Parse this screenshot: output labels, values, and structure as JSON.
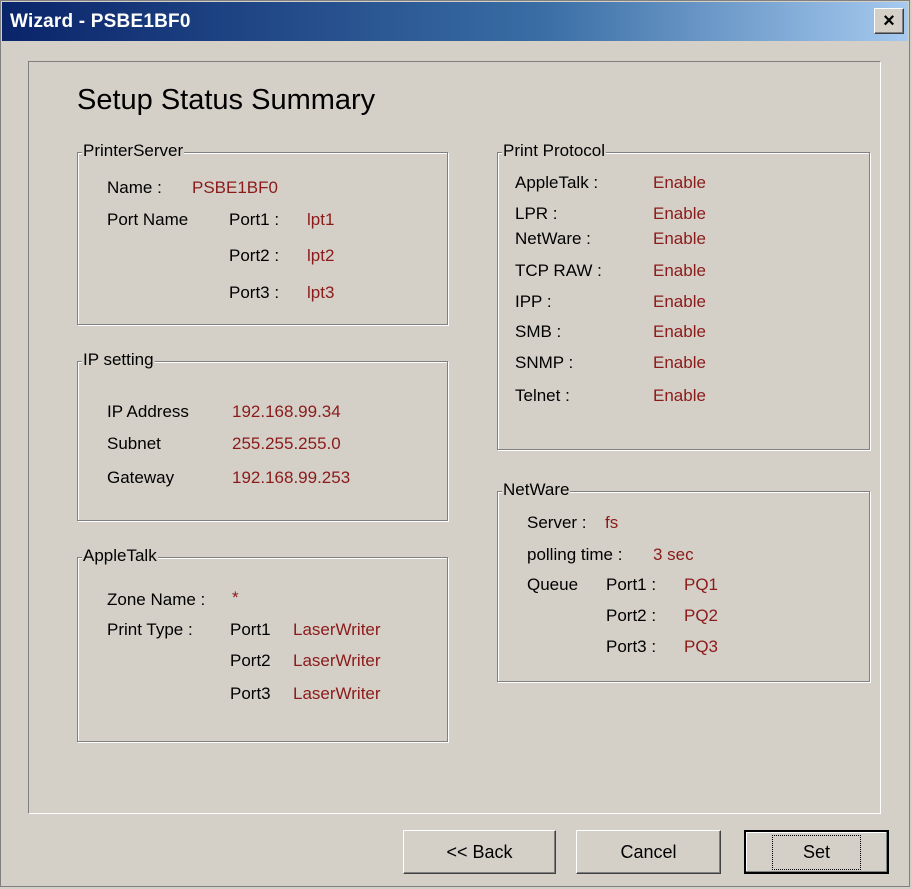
{
  "window": {
    "title": "Wizard - PSBE1BF0",
    "close_glyph": "×"
  },
  "heading": "Setup Status Summary",
  "printer_server": {
    "legend": "PrinterServer",
    "name_label": "Name :",
    "name_value": "PSBE1BF0",
    "port_name_label": "Port Name",
    "ports": [
      {
        "label": "Port1 :",
        "value": "lpt1"
      },
      {
        "label": "Port2 :",
        "value": "lpt2"
      },
      {
        "label": "Port3 :",
        "value": "lpt3"
      }
    ]
  },
  "ip_setting": {
    "legend": "IP setting",
    "rows": [
      {
        "label": "IP Address",
        "value": "192.168.99.34"
      },
      {
        "label": "Subnet",
        "value": "255.255.255.0"
      },
      {
        "label": "Gateway",
        "value": "192.168.99.253"
      }
    ]
  },
  "appletalk": {
    "legend": "AppleTalk",
    "zone_label": "Zone Name :",
    "zone_value": "*",
    "print_type_label": "Print Type :",
    "ports": [
      {
        "label": "Port1",
        "value": "LaserWriter"
      },
      {
        "label": "Port2",
        "value": "LaserWriter"
      },
      {
        "label": "Port3",
        "value": "LaserWriter"
      }
    ]
  },
  "print_protocol": {
    "legend": "Print Protocol",
    "rows": [
      {
        "label": "AppleTalk :",
        "value": "Enable"
      },
      {
        "label": "LPR :",
        "value": "Enable"
      },
      {
        "label": "NetWare :",
        "value": "Enable"
      },
      {
        "label": "TCP RAW :",
        "value": "Enable"
      },
      {
        "label": "IPP :",
        "value": "Enable"
      },
      {
        "label": "SMB :",
        "value": "Enable"
      },
      {
        "label": "SNMP :",
        "value": "Enable"
      },
      {
        "label": "Telnet :",
        "value": "Enable"
      }
    ]
  },
  "netware": {
    "legend": "NetWare",
    "server_label": "Server :",
    "server_value": "fs",
    "polling_label": "polling time :",
    "polling_value": "3 sec",
    "queue_label": "Queue",
    "ports": [
      {
        "label": "Port1 :",
        "value": "PQ1"
      },
      {
        "label": "Port2 :",
        "value": "PQ2"
      },
      {
        "label": "Port3 :",
        "value": "PQ3"
      }
    ]
  },
  "buttons": {
    "back": "<< Back",
    "cancel": "Cancel",
    "set": "Set"
  },
  "colors": {
    "value_text": "#8b1a1a",
    "dialog_face": "#d4d0c8",
    "titlebar": "#0a246a"
  }
}
